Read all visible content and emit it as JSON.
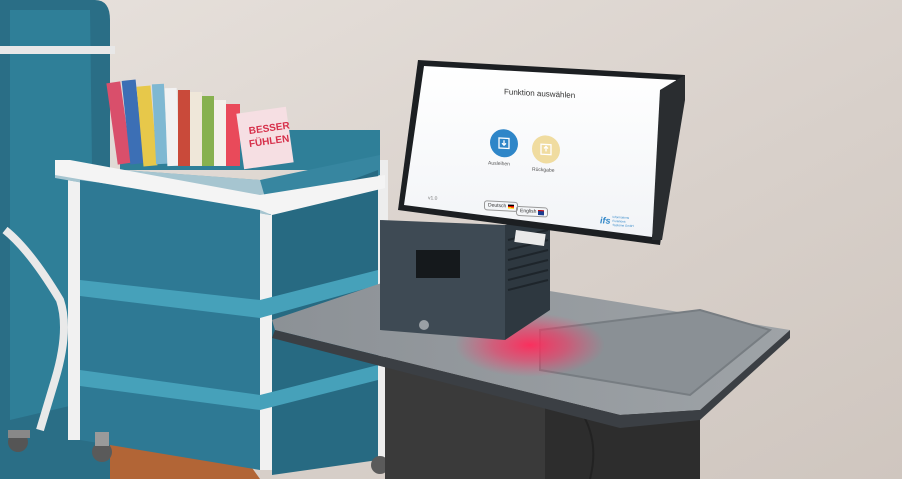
{
  "kiosk": {
    "screen_title": "Funktion auswählen",
    "functions": [
      {
        "label": "Ausleihen",
        "icon": "return-box-icon",
        "color": "#2f86c8"
      },
      {
        "label": "Rückgabe",
        "icon": "return-box-icon",
        "color": "#f0dca0"
      }
    ],
    "footer_left": "v1.0",
    "languages": [
      {
        "label": "Deutsch",
        "icon": "german-flag-icon"
      },
      {
        "label": "English",
        "icon": "uk-flag-icon"
      }
    ],
    "brand_logo_text": "ifs",
    "brand_lines": [
      "Informations",
      "Funktions",
      "Systeme GmbH"
    ],
    "scanner_light_color": "#ff1a4a"
  },
  "books": {
    "sign_lines": [
      "BESSER",
      "FÜHLEN"
    ]
  },
  "colors": {
    "wall": "#ddd6d0",
    "floor": "#b76436",
    "shelf_teal": "#2f7f98",
    "kiosk_dark": "#3b4750",
    "desk": "#8e949a"
  }
}
